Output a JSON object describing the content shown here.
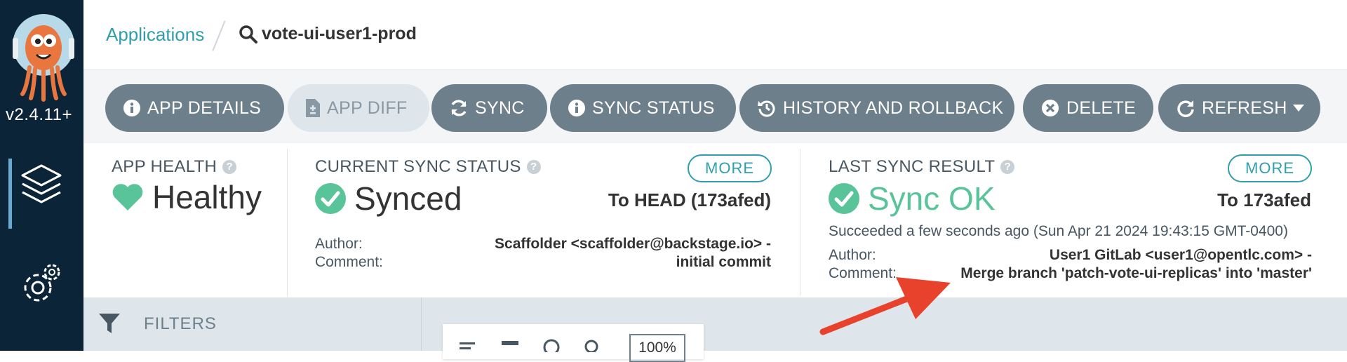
{
  "sidebar": {
    "version": "v2.4.11+",
    "icons": [
      "argo-logo",
      "layers-icon",
      "gear-icon"
    ]
  },
  "breadcrumb": {
    "root": "Applications",
    "app": "vote-ui-user1-prod"
  },
  "toolbar": {
    "app_details": "APP DETAILS",
    "app_diff": "APP DIFF",
    "sync": "SYNC",
    "sync_status": "SYNC STATUS",
    "history": "HISTORY AND ROLLBACK",
    "delete": "DELETE",
    "refresh": "REFRESH"
  },
  "app_health": {
    "title": "APP HEALTH",
    "status": "Healthy"
  },
  "current_sync": {
    "title": "CURRENT SYNC STATUS",
    "more": "MORE",
    "status": "Synced",
    "target": "To HEAD (173afed)",
    "author_label": "Author:",
    "comment_label": "Comment:",
    "author": "Scaffolder <scaffolder@backstage.io> -",
    "comment": "initial commit"
  },
  "last_sync": {
    "title": "LAST SYNC RESULT",
    "more": "MORE",
    "status": "Sync OK",
    "target": "To 173afed",
    "time": "Succeeded a few seconds ago (Sun Apr 21 2024 19:43:15 GMT-0400)",
    "author_label": "Author:",
    "comment_label": "Comment:",
    "author": "User1 GitLab <user1@opentlc.com> -",
    "comment": "Merge branch 'patch-vote-ui-replicas' into 'master'"
  },
  "filters": {
    "label": "FILTERS"
  },
  "view": {
    "zoom": "100%"
  },
  "colors": {
    "sidebar": "#0b2438",
    "button": "#6d7f8b",
    "accent": "#2f9fab",
    "healthy": "#59c49a",
    "annotation": "#e8412c"
  }
}
